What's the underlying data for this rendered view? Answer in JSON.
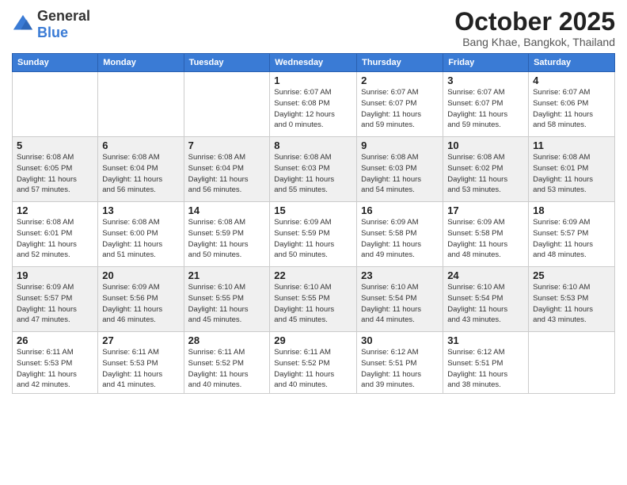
{
  "header": {
    "logo_general": "General",
    "logo_blue": "Blue",
    "month": "October 2025",
    "location": "Bang Khae, Bangkok, Thailand"
  },
  "weekdays": [
    "Sunday",
    "Monday",
    "Tuesday",
    "Wednesday",
    "Thursday",
    "Friday",
    "Saturday"
  ],
  "weeks": [
    [
      {
        "day": "",
        "info": ""
      },
      {
        "day": "",
        "info": ""
      },
      {
        "day": "",
        "info": ""
      },
      {
        "day": "1",
        "info": "Sunrise: 6:07 AM\nSunset: 6:08 PM\nDaylight: 12 hours\nand 0 minutes."
      },
      {
        "day": "2",
        "info": "Sunrise: 6:07 AM\nSunset: 6:07 PM\nDaylight: 11 hours\nand 59 minutes."
      },
      {
        "day": "3",
        "info": "Sunrise: 6:07 AM\nSunset: 6:07 PM\nDaylight: 11 hours\nand 59 minutes."
      },
      {
        "day": "4",
        "info": "Sunrise: 6:07 AM\nSunset: 6:06 PM\nDaylight: 11 hours\nand 58 minutes."
      }
    ],
    [
      {
        "day": "5",
        "info": "Sunrise: 6:08 AM\nSunset: 6:05 PM\nDaylight: 11 hours\nand 57 minutes."
      },
      {
        "day": "6",
        "info": "Sunrise: 6:08 AM\nSunset: 6:04 PM\nDaylight: 11 hours\nand 56 minutes."
      },
      {
        "day": "7",
        "info": "Sunrise: 6:08 AM\nSunset: 6:04 PM\nDaylight: 11 hours\nand 56 minutes."
      },
      {
        "day": "8",
        "info": "Sunrise: 6:08 AM\nSunset: 6:03 PM\nDaylight: 11 hours\nand 55 minutes."
      },
      {
        "day": "9",
        "info": "Sunrise: 6:08 AM\nSunset: 6:03 PM\nDaylight: 11 hours\nand 54 minutes."
      },
      {
        "day": "10",
        "info": "Sunrise: 6:08 AM\nSunset: 6:02 PM\nDaylight: 11 hours\nand 53 minutes."
      },
      {
        "day": "11",
        "info": "Sunrise: 6:08 AM\nSunset: 6:01 PM\nDaylight: 11 hours\nand 53 minutes."
      }
    ],
    [
      {
        "day": "12",
        "info": "Sunrise: 6:08 AM\nSunset: 6:01 PM\nDaylight: 11 hours\nand 52 minutes."
      },
      {
        "day": "13",
        "info": "Sunrise: 6:08 AM\nSunset: 6:00 PM\nDaylight: 11 hours\nand 51 minutes."
      },
      {
        "day": "14",
        "info": "Sunrise: 6:08 AM\nSunset: 5:59 PM\nDaylight: 11 hours\nand 50 minutes."
      },
      {
        "day": "15",
        "info": "Sunrise: 6:09 AM\nSunset: 5:59 PM\nDaylight: 11 hours\nand 50 minutes."
      },
      {
        "day": "16",
        "info": "Sunrise: 6:09 AM\nSunset: 5:58 PM\nDaylight: 11 hours\nand 49 minutes."
      },
      {
        "day": "17",
        "info": "Sunrise: 6:09 AM\nSunset: 5:58 PM\nDaylight: 11 hours\nand 48 minutes."
      },
      {
        "day": "18",
        "info": "Sunrise: 6:09 AM\nSunset: 5:57 PM\nDaylight: 11 hours\nand 48 minutes."
      }
    ],
    [
      {
        "day": "19",
        "info": "Sunrise: 6:09 AM\nSunset: 5:57 PM\nDaylight: 11 hours\nand 47 minutes."
      },
      {
        "day": "20",
        "info": "Sunrise: 6:09 AM\nSunset: 5:56 PM\nDaylight: 11 hours\nand 46 minutes."
      },
      {
        "day": "21",
        "info": "Sunrise: 6:10 AM\nSunset: 5:55 PM\nDaylight: 11 hours\nand 45 minutes."
      },
      {
        "day": "22",
        "info": "Sunrise: 6:10 AM\nSunset: 5:55 PM\nDaylight: 11 hours\nand 45 minutes."
      },
      {
        "day": "23",
        "info": "Sunrise: 6:10 AM\nSunset: 5:54 PM\nDaylight: 11 hours\nand 44 minutes."
      },
      {
        "day": "24",
        "info": "Sunrise: 6:10 AM\nSunset: 5:54 PM\nDaylight: 11 hours\nand 43 minutes."
      },
      {
        "day": "25",
        "info": "Sunrise: 6:10 AM\nSunset: 5:53 PM\nDaylight: 11 hours\nand 43 minutes."
      }
    ],
    [
      {
        "day": "26",
        "info": "Sunrise: 6:11 AM\nSunset: 5:53 PM\nDaylight: 11 hours\nand 42 minutes."
      },
      {
        "day": "27",
        "info": "Sunrise: 6:11 AM\nSunset: 5:53 PM\nDaylight: 11 hours\nand 41 minutes."
      },
      {
        "day": "28",
        "info": "Sunrise: 6:11 AM\nSunset: 5:52 PM\nDaylight: 11 hours\nand 40 minutes."
      },
      {
        "day": "29",
        "info": "Sunrise: 6:11 AM\nSunset: 5:52 PM\nDaylight: 11 hours\nand 40 minutes."
      },
      {
        "day": "30",
        "info": "Sunrise: 6:12 AM\nSunset: 5:51 PM\nDaylight: 11 hours\nand 39 minutes."
      },
      {
        "day": "31",
        "info": "Sunrise: 6:12 AM\nSunset: 5:51 PM\nDaylight: 11 hours\nand 38 minutes."
      },
      {
        "day": "",
        "info": ""
      }
    ]
  ]
}
